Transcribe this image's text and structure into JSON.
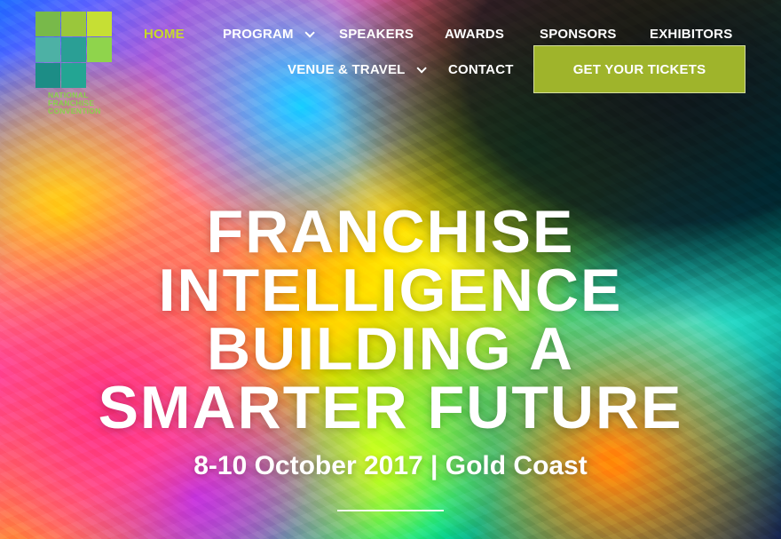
{
  "logo": {
    "text_line_1": "NATIONAL",
    "text_line_2": "FRANCHISE",
    "text_line_3": "CONVENTION"
  },
  "nav": {
    "home": "HOME",
    "program": "PROGRAM",
    "speakers": "SPEAKERS",
    "awards": "AWARDS",
    "sponsors": "SPONSORS",
    "exhibitors": "EXHIBITORS",
    "venue_travel": "VENUE & TRAVEL",
    "contact": "CONTACT",
    "tickets_button": "GET YOUR TICKETS",
    "active_color": "#c7d82c",
    "button_color": "#9fb42b"
  },
  "hero": {
    "headline_line_1": "FRANCHISE",
    "headline_line_2": "INTELLIGENCE",
    "headline_line_3": "BUILDING A",
    "headline_line_4": "SMARTER FUTURE",
    "event_info": "8-10 October 2017 | Gold Coast"
  },
  "icons": {
    "program": "chevron-down-icon",
    "venue_travel": "chevron-down-icon"
  }
}
